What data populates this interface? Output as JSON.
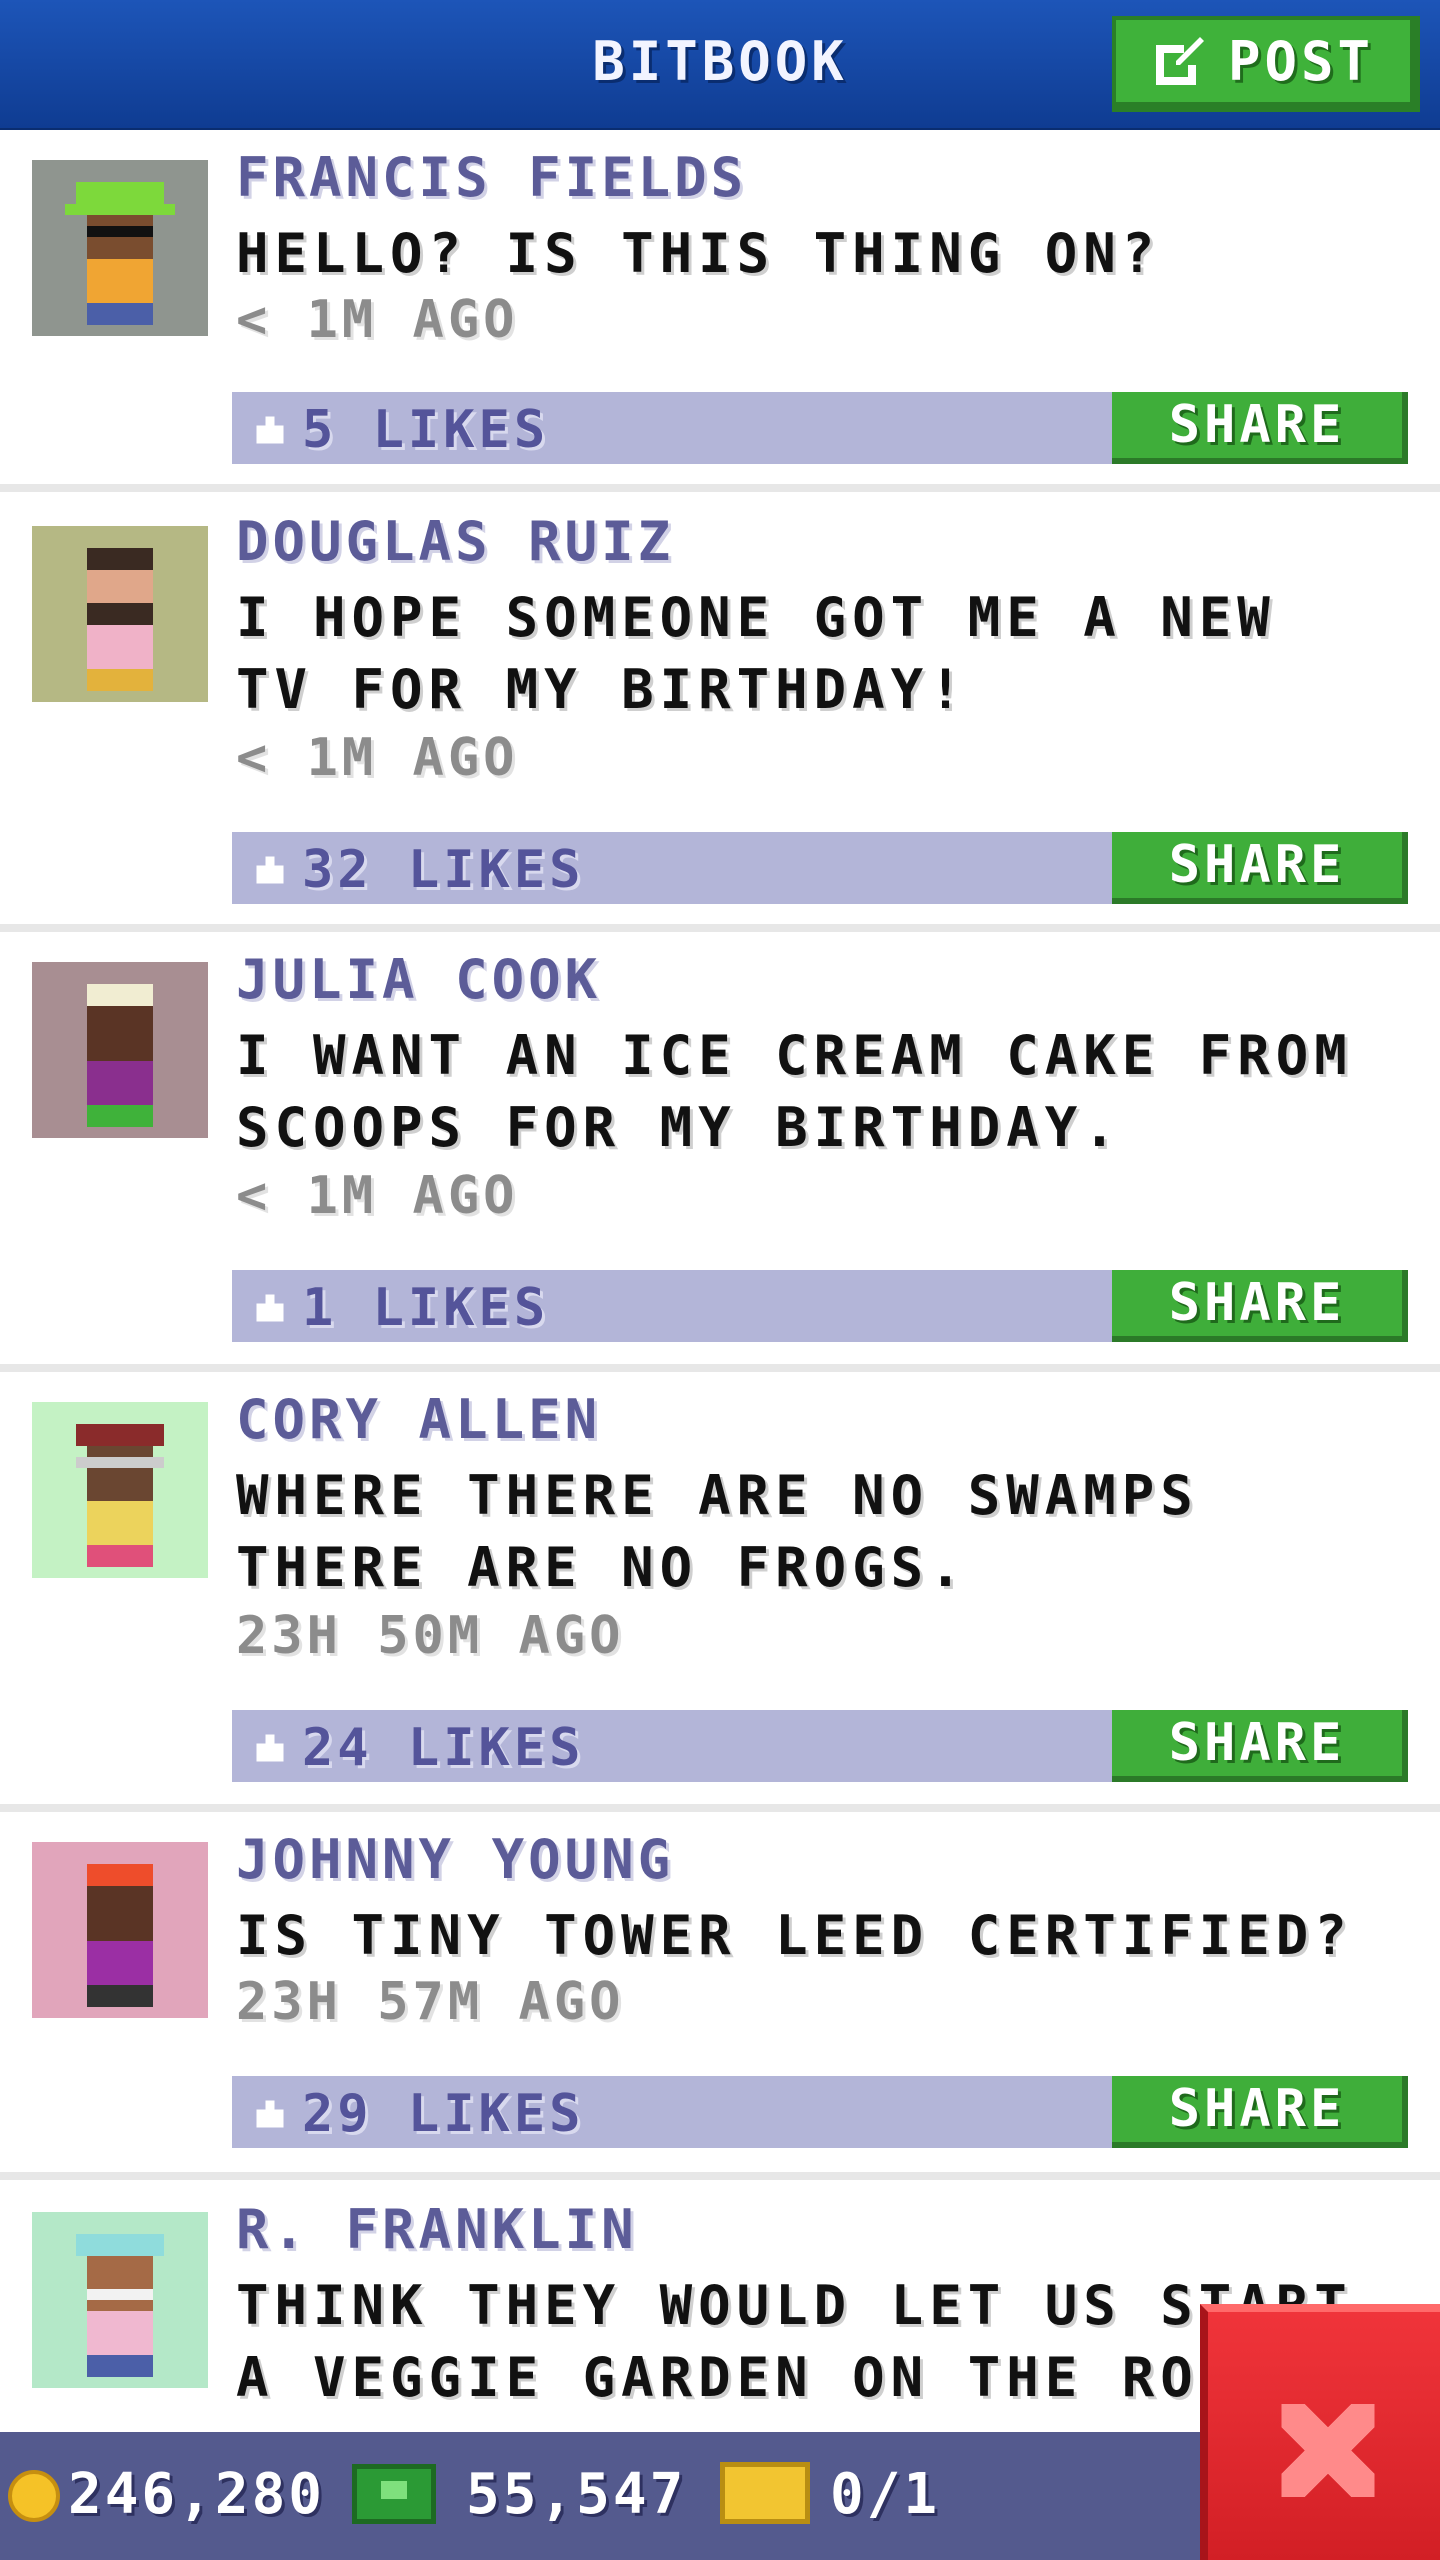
{
  "header": {
    "title": "BITBOOK",
    "post_label": "POST"
  },
  "posts": [
    {
      "author": "FRANCIS FIELDS",
      "message": "HELLO? IS THIS THING ON?",
      "time": "< 1M AGO",
      "likes": "5 LIKES",
      "share": "SHARE",
      "avatar_bg": "#8f958f",
      "hat": "#7dd93b",
      "shirt": "#f0a533",
      "skin": "#7a4d2f"
    },
    {
      "author": "DOUGLAS RUIZ",
      "message": "I HOPE SOMEONE GOT ME A NEW TV FOR MY BIRTHDAY!",
      "time": "< 1M AGO",
      "likes": "32 LIKES",
      "share": "SHARE",
      "avatar_bg": "#b5b884",
      "hat": "#3a2a22",
      "shirt": "#f0b2c8",
      "skin": "#e0a78a"
    },
    {
      "author": "JULIA COOK",
      "message": "I WANT AN ICE CREAM CAKE FROM SCOOPS FOR MY BIRTHDAY.",
      "time": "< 1M AGO",
      "likes": "1 LIKES",
      "share": "SHARE",
      "avatar_bg": "#a88e92",
      "hat": "#f1edd2",
      "shirt": "#8a2f8e",
      "skin": "#5a3425"
    },
    {
      "author": "CORY ALLEN",
      "message": "WHERE THERE ARE NO SWAMPS THERE ARE NO FROGS.",
      "time": "23H 50M AGO",
      "likes": "24 LIKES",
      "share": "SHARE",
      "avatar_bg": "#c4f2c4",
      "hat": "#8a2b2b",
      "shirt": "#ecd35c",
      "skin": "#6a4631"
    },
    {
      "author": "JOHNNY YOUNG",
      "message": "IS TINY TOWER LEED CERTIFIED?",
      "time": "23H 57M AGO",
      "likes": "29 LIKES",
      "share": "SHARE",
      "avatar_bg": "#e1a5bb",
      "hat": "#ee4d2b",
      "shirt": "#9b2fa4",
      "skin": "#5a3425"
    },
    {
      "author": "R. FRANKLIN",
      "message": "THINK THEY WOULD LET US START A VEGGIE GARDEN ON THE ROOF?",
      "time": "",
      "likes": "",
      "share": "",
      "avatar_bg": "#b4e8c8",
      "hat": "#8fdcdc",
      "shirt": "#f0b8d0",
      "skin": "#a56a46"
    }
  ],
  "bottom_bar": {
    "coins": "246,280",
    "bux": "55,547",
    "tickets": "0/1"
  },
  "colors": {
    "header": "#1d55b8",
    "share": "#3fae3a",
    "likes_bar": "#b3b5d8",
    "close": "#e32a30"
  },
  "icons": {
    "post": "edit-icon",
    "close": "close-icon",
    "likes": "thumb-icon"
  }
}
